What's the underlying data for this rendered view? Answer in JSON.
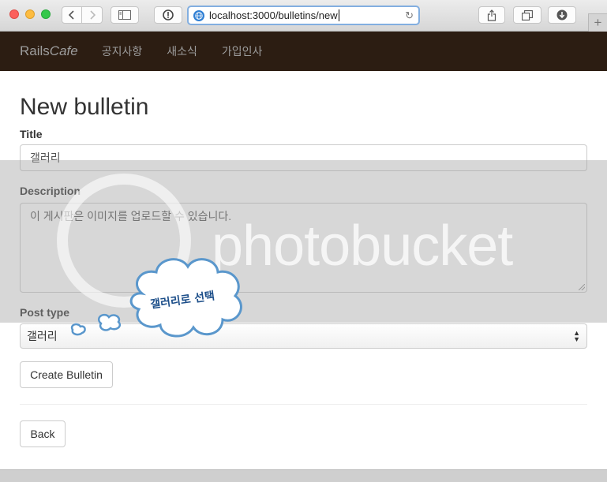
{
  "browser": {
    "url": "localhost:3000/bulletins/new",
    "reload_glyph": "↻",
    "newtab_glyph": "+"
  },
  "navbar": {
    "brand_prefix": "Rails",
    "brand_suffix": "Cafe",
    "links": [
      "공지사항",
      "새소식",
      "가입인사"
    ],
    "background": "#2c1d12"
  },
  "page": {
    "heading": "New bulletin"
  },
  "form": {
    "title_label": "Title",
    "title_value": "갤러리",
    "description_label": "Description",
    "description_value": "이 게시판은 이미지를 업로드할 수 있습니다.",
    "post_type_label": "Post type",
    "post_type_value": "갤러리",
    "submit_label": "Create Bulletin"
  },
  "back_label": "Back",
  "watermark": {
    "text": "photobucket"
  },
  "annotation": {
    "text": "갤러리로 선택"
  }
}
